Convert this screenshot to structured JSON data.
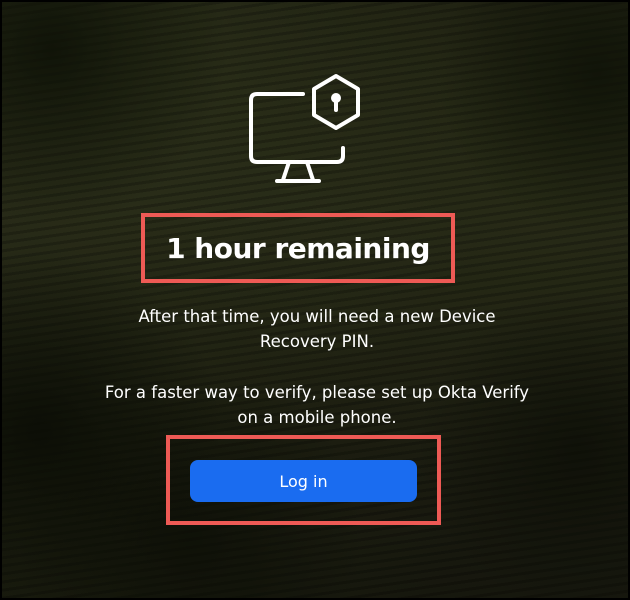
{
  "icon": "computer-lock-icon",
  "title": "1 hour remaining",
  "message_line1": "After that time, you will need a new Device",
  "message_line2": "Recovery PIN.",
  "message_line3": "For a faster way to verify, please set up Okta Verify",
  "message_line4": "on a mobile phone.",
  "login_button_label": "Log in",
  "colors": {
    "accent": "#1a6cf0",
    "highlight": "#ee5a55",
    "text": "#ffffff"
  }
}
